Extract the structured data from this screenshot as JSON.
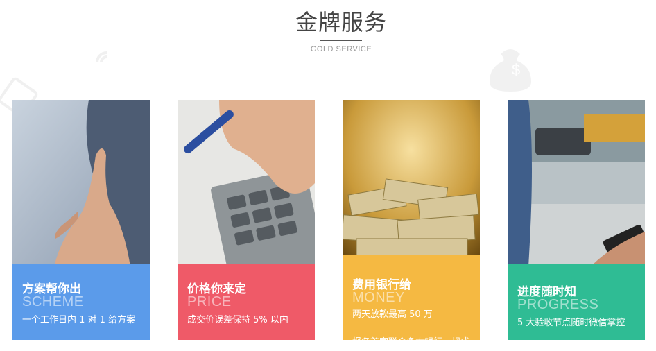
{
  "header": {
    "title": "金牌服务",
    "subtitle": "GOLD SERVICE"
  },
  "cards": [
    {
      "title_cn": "方案帮你出",
      "title_en": "SCHEME",
      "description": "一个工作日内 1 对 1 给方案",
      "color": "#5b9bea",
      "photo": "handshake-photo"
    },
    {
      "title_cn": "价格你来定",
      "title_en": "PRICE",
      "description": "成交价误差保持 5% 以内",
      "color": "#ef5a68",
      "photo": "calculator-photo"
    },
    {
      "title_cn": "费用银行给",
      "title_en": "MONEY",
      "description": "两天放款最高 50 万",
      "description2": "报名首家联合多大银行，规成",
      "color": "#f5b942",
      "photo": "money-pile-photo"
    },
    {
      "title_cn": "进度随时知",
      "title_en": "PROGRESS",
      "description": "5 大验收节点随时微信掌控",
      "color": "#2fbc94",
      "photo": "phone-street-photo"
    }
  ]
}
